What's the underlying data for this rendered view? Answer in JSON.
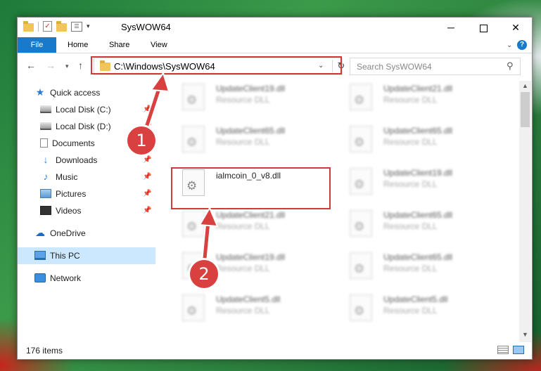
{
  "window": {
    "title": "SysWOW64",
    "controls": {
      "minimize": "─",
      "maximize": "",
      "close": "✕"
    }
  },
  "ribbon": {
    "tabs": [
      "File",
      "Home",
      "Share",
      "View"
    ],
    "help": "?"
  },
  "address": {
    "path": "C:\\Windows\\SysWOW64",
    "refresh_icon": "↻",
    "dropdown_icon": "⌄"
  },
  "search": {
    "placeholder": "Search SysWOW64"
  },
  "nav_pane": {
    "items": [
      {
        "label": "Quick access",
        "icon": "star-icon",
        "pinned": false
      },
      {
        "label": "Local Disk (C:)",
        "icon": "drive-icon",
        "pinned": true
      },
      {
        "label": "Local Disk (D:)",
        "icon": "drive-icon",
        "pinned": true
      },
      {
        "label": "Documents",
        "icon": "documents-icon",
        "pinned": true
      },
      {
        "label": "Downloads",
        "icon": "download-icon",
        "pinned": true
      },
      {
        "label": "Music",
        "icon": "music-icon",
        "pinned": true
      },
      {
        "label": "Pictures",
        "icon": "pictures-icon",
        "pinned": true
      },
      {
        "label": "Videos",
        "icon": "videos-icon",
        "pinned": true
      },
      {
        "label": "OneDrive",
        "icon": "onedrive-icon",
        "pinned": false
      },
      {
        "label": "This PC",
        "icon": "pc-icon",
        "pinned": false,
        "selected": true
      },
      {
        "label": "Network",
        "icon": "network-icon",
        "pinned": false
      }
    ]
  },
  "files": {
    "highlighted": {
      "name": "ialmcoin_0_v8.dll"
    },
    "blurred": [
      {
        "name": "UpdateClient19.dll",
        "type": "Resource DLL"
      },
      {
        "name": "UpdateClient21.dll",
        "type": "Resource DLL"
      },
      {
        "name": "UpdateClient65.dll",
        "type": "Resource DLL"
      },
      {
        "name": "UpdateClient65.dll",
        "type": "Resource DLL"
      },
      {
        "name": "UpdateClient19.dll",
        "type": "Resource DLL"
      },
      {
        "name": "UpdateClient21.dll",
        "type": "Resource DLL"
      },
      {
        "name": "UpdateClient65.dll",
        "type": "Resource DLL"
      },
      {
        "name": "UpdateClient19.dll",
        "type": "Resource DLL"
      },
      {
        "name": "UpdateClient65.dll",
        "type": "Resource DLL"
      },
      {
        "name": "UpdateClient5.dll",
        "type": "Resource DLL"
      },
      {
        "name": "UpdateClient5.dll",
        "type": "Resource DLL"
      }
    ]
  },
  "status": {
    "count": "176 items"
  },
  "annotations": {
    "marker1": "1",
    "marker2": "2",
    "color": "#d03a3a"
  }
}
